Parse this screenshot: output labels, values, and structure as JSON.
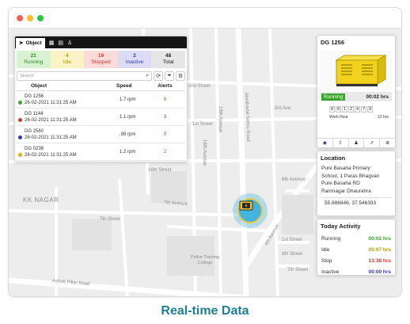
{
  "caption": "Real-time Data",
  "colors": {
    "accent": "#1f7f97",
    "running": "#3aa52c",
    "idle": "#b49a00",
    "stopped": "#d23a2b",
    "inactive": "#2d38b6",
    "marker": "#45b4dc"
  },
  "map": {
    "area": "KK NAGAR",
    "streets": [
      "2nd Street",
      "1st Street",
      "19th Avenue",
      "Jawaharlal Nehru Road",
      "3rd Ave",
      "18th Avenue",
      "16th Street",
      "7th Avenue",
      "6th Avenue",
      "7th Street",
      "4th Avenue",
      "1st Street",
      "8th Street",
      "7th Street",
      "Ashok Pillar Road"
    ],
    "place": "Police Training College"
  },
  "left_panel": {
    "tabs": [
      {
        "label": "Object",
        "icon": "navigation-icon"
      },
      {
        "label": "",
        "icon": "calendar-icon"
      },
      {
        "label": "",
        "icon": "grid-icon"
      },
      {
        "label": "",
        "icon": "user-icon"
      }
    ],
    "stats": [
      {
        "count": "21",
        "label": "Running"
      },
      {
        "count": "4",
        "label": "Idle"
      },
      {
        "count": "19",
        "label": "Stopped"
      },
      {
        "count": "2",
        "label": "Inactive"
      },
      {
        "count": "48",
        "label": "Total"
      }
    ],
    "search_placeholder": "Search",
    "columns": {
      "object": "Object",
      "speed": "Speed",
      "alerts": "Alerts"
    },
    "rows": [
      {
        "name": "DG 1256",
        "time": "26-02-2021 11:31:25 AM",
        "speed": "1.7 rpm",
        "alerts": "8",
        "status": "running"
      },
      {
        "name": "DG 1144",
        "time": "26-02-2021 11:31:25 AM",
        "speed": "1.1 rpm",
        "alerts": "3",
        "status": "stopped"
      },
      {
        "name": "DG 2560",
        "time": "26-02-2021 11:31:25 AM",
        "speed": ".98 rpm",
        "alerts": "0",
        "status": "inactive"
      },
      {
        "name": "DG 0238",
        "time": "26-02-2021 11:31:25 AM",
        "speed": "1.2 rpm",
        "alerts": "2",
        "status": "idle"
      }
    ]
  },
  "device_panel": {
    "title": "DG 1256",
    "status": "Running",
    "status_time": "00:02 hrs",
    "digits": [
      "0",
      "0",
      "1",
      "2",
      "4",
      "7",
      "9"
    ],
    "work_hour_label": "Work Hour",
    "work_hour_value": "12 hrs",
    "actions": [
      "eye-icon",
      "share-icon",
      "person-icon",
      "navigate-icon",
      "zoom-icon"
    ]
  },
  "location_panel": {
    "title": "Location",
    "address": [
      "Pure Basaha Primary",
      "School, 1 Paras Bhagvan",
      "Pure Basaha RD",
      "Ramnagar Dhaurahra"
    ],
    "coords": "55.886846, 37.546393"
  },
  "activity_panel": {
    "title": "Today Activity",
    "rows": [
      {
        "label": "Running",
        "value": "00:02 hrs"
      },
      {
        "label": "Idle",
        "value": "03:07 hrs"
      },
      {
        "label": "Stop",
        "value": "13:38 hrs"
      },
      {
        "label": "Inactive",
        "value": "00:00 hrs"
      }
    ]
  }
}
